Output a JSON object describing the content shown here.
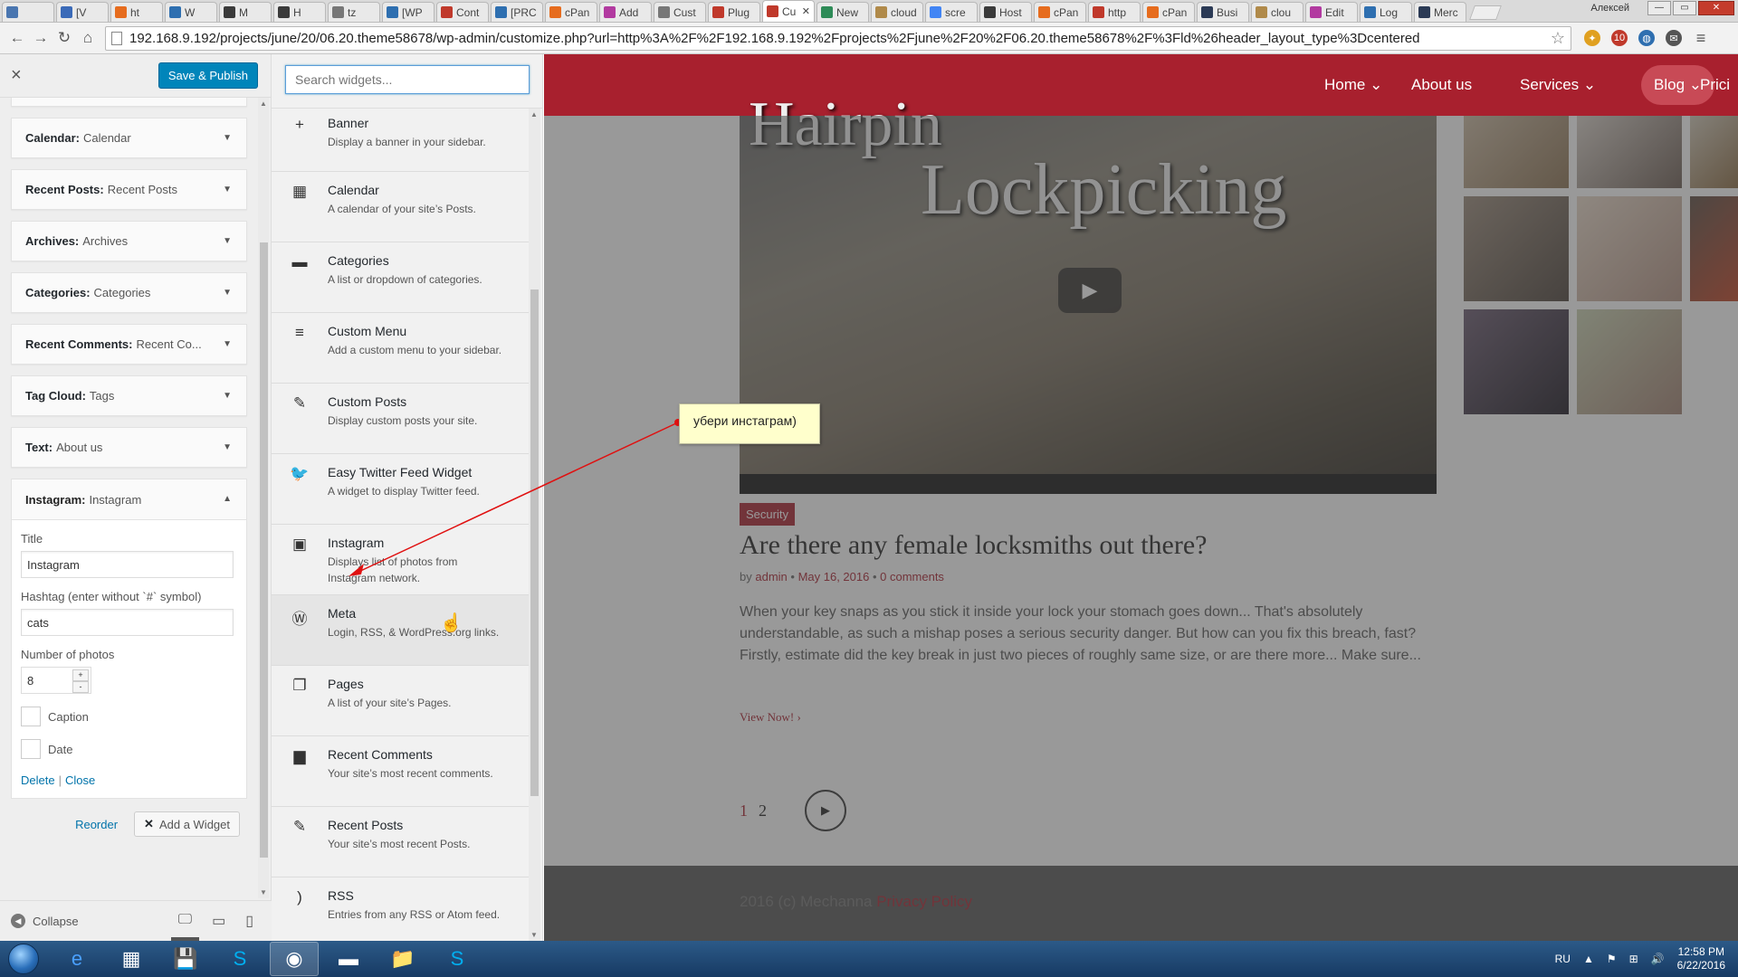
{
  "browser": {
    "tabs": [
      {
        "label": "",
        "color": "#4a76b0"
      },
      {
        "label": "[V",
        "color": "#3a6ab8"
      },
      {
        "label": "ht",
        "color": "#e66c1e"
      },
      {
        "label": "W",
        "color": "#2e6fb0"
      },
      {
        "label": "M",
        "color": "#3a3a3a"
      },
      {
        "label": "H",
        "color": "#3a3a3a"
      },
      {
        "label": "tz",
        "color": "#777777"
      },
      {
        "label": "[WP",
        "color": "#2e6fb0"
      },
      {
        "label": "Cont",
        "color": "#c0392b"
      },
      {
        "label": "[PRC",
        "color": "#2e6fb0"
      },
      {
        "label": "cPan",
        "color": "#e66c1e"
      },
      {
        "label": "Add",
        "color": "#b23aa0"
      },
      {
        "label": "Cust",
        "color": "#777777"
      },
      {
        "label": "Plug",
        "color": "#c0392b"
      },
      {
        "label": "Cu",
        "color": "#c0392b"
      },
      {
        "label": "New",
        "color": "#2e8b57"
      },
      {
        "label": "cloud",
        "color": "#b08a4a"
      },
      {
        "label": "scre",
        "color": "#4285f4"
      },
      {
        "label": "Host",
        "color": "#3a3a3a"
      },
      {
        "label": "cPan",
        "color": "#e66c1e"
      },
      {
        "label": "http",
        "color": "#c0392b"
      },
      {
        "label": "cPan",
        "color": "#e66c1e"
      },
      {
        "label": "Busi",
        "color": "#2b3a55"
      },
      {
        "label": "clou",
        "color": "#b08a4a"
      },
      {
        "label": "Edit",
        "color": "#b23aa0"
      },
      {
        "label": "Log",
        "color": "#2e6fb0"
      },
      {
        "label": "Merc",
        "color": "#2b3a55"
      }
    ],
    "active_tab_index": 14,
    "user_name": "Алексей",
    "url": "192.168.9.192/projects/june/20/06.20.theme58678/wp-admin/customize.php?url=http%3A%2F%2F192.168.9.192%2Fprojects%2Fjune%2F20%2F06.20.theme58678%2F%3Fld%26header_layout_type%3Dcentered",
    "window_controls": {
      "minimize": "—",
      "maximize": "▭",
      "close": "✕"
    },
    "adblock_badge": "10"
  },
  "customizer": {
    "close_icon": "×",
    "save_label": "Save & Publish",
    "widgets": [
      {
        "type": "Calendar:",
        "title": "Calendar"
      },
      {
        "type": "Recent Posts:",
        "title": "Recent Posts"
      },
      {
        "type": "Archives:",
        "title": "Archives"
      },
      {
        "type": "Categories:",
        "title": "Categories"
      },
      {
        "type": "Recent Comments:",
        "title": "Recent Co..."
      },
      {
        "type": "Tag Cloud:",
        "title": "Tags"
      },
      {
        "type": "Text:",
        "title": "About us"
      }
    ],
    "instagram": {
      "type": "Instagram:",
      "title": "Instagram",
      "title_label": "Title",
      "title_value": "Instagram",
      "hashtag_label": "Hashtag (enter without `#` symbol)",
      "hashtag_value": "cats",
      "photos_label": "Number of photos",
      "photos_value": "8",
      "caption_label": "Caption",
      "date_label": "Date",
      "delete_label": "Delete",
      "close_label": "Close"
    },
    "reorder_label": "Reorder",
    "add_widget_label": "Add a Widget",
    "collapse_label": "Collapse"
  },
  "available": {
    "search_placeholder": "Search widgets...",
    "items": [
      {
        "icon": "+",
        "title": "Banner",
        "desc": "Display a banner in your sidebar."
      },
      {
        "icon": "▦",
        "title": "Calendar",
        "desc": "A calendar of your site’s Posts."
      },
      {
        "icon": "▬",
        "title": "Categories",
        "desc": "A list or dropdown of categories."
      },
      {
        "icon": "≡",
        "title": "Custom Menu",
        "desc": "Add a custom menu to your sidebar."
      },
      {
        "icon": "✎",
        "title": "Custom Posts",
        "desc": "Display custom posts your site."
      },
      {
        "icon": "🐦",
        "title": "Easy Twitter Feed Widget",
        "desc": "A widget to display Twitter feed."
      },
      {
        "icon": "▣",
        "title": "Instagram",
        "desc": "Displays list of photos from Instagram network."
      },
      {
        "icon": "Ⓦ",
        "title": "Meta",
        "desc": "Login, RSS, & WordPress.org links."
      },
      {
        "icon": "❐",
        "title": "Pages",
        "desc": "A list of your site’s Pages."
      },
      {
        "icon": "▆",
        "title": "Recent Comments",
        "desc": "Your site’s most recent comments."
      },
      {
        "icon": "✎",
        "title": "Recent Posts",
        "desc": "Your site’s most recent Posts."
      },
      {
        "icon": ")",
        "title": "RSS",
        "desc": "Entries from any RSS or Atom feed."
      }
    ]
  },
  "site": {
    "nav": [
      "Home",
      "About us",
      "Services",
      "Blog",
      "Prici"
    ],
    "video_title_1": "Hairpin",
    "video_title_2": "Lockpicking",
    "category": "Security",
    "post_title": "Are there any female locksmiths out there?",
    "post_meta_by": "by",
    "post_author": "admin",
    "post_date": "May 16, 2016",
    "post_comments": "0 comments",
    "excerpt": "When your key snaps as you stick it inside your lock your stomach goes down... That's absolutely understandable, as such a mishap poses a serious security danger. But how can you fix this breach, fast? Firstly, estimate did the key break in just two pieces of roughly same size, or are there more... Make sure...",
    "view_now": "View Now! ›",
    "pages": [
      "1",
      "2"
    ],
    "footer_text": "2016 (c) Mechanna",
    "footer_link": "Privacy Policy",
    "accent_color": "#a8202e"
  },
  "annotation": {
    "note_text": "убери инстаграм)"
  },
  "taskbar": {
    "lang": "RU",
    "time": "12:58 PM",
    "date": "6/22/2016"
  }
}
